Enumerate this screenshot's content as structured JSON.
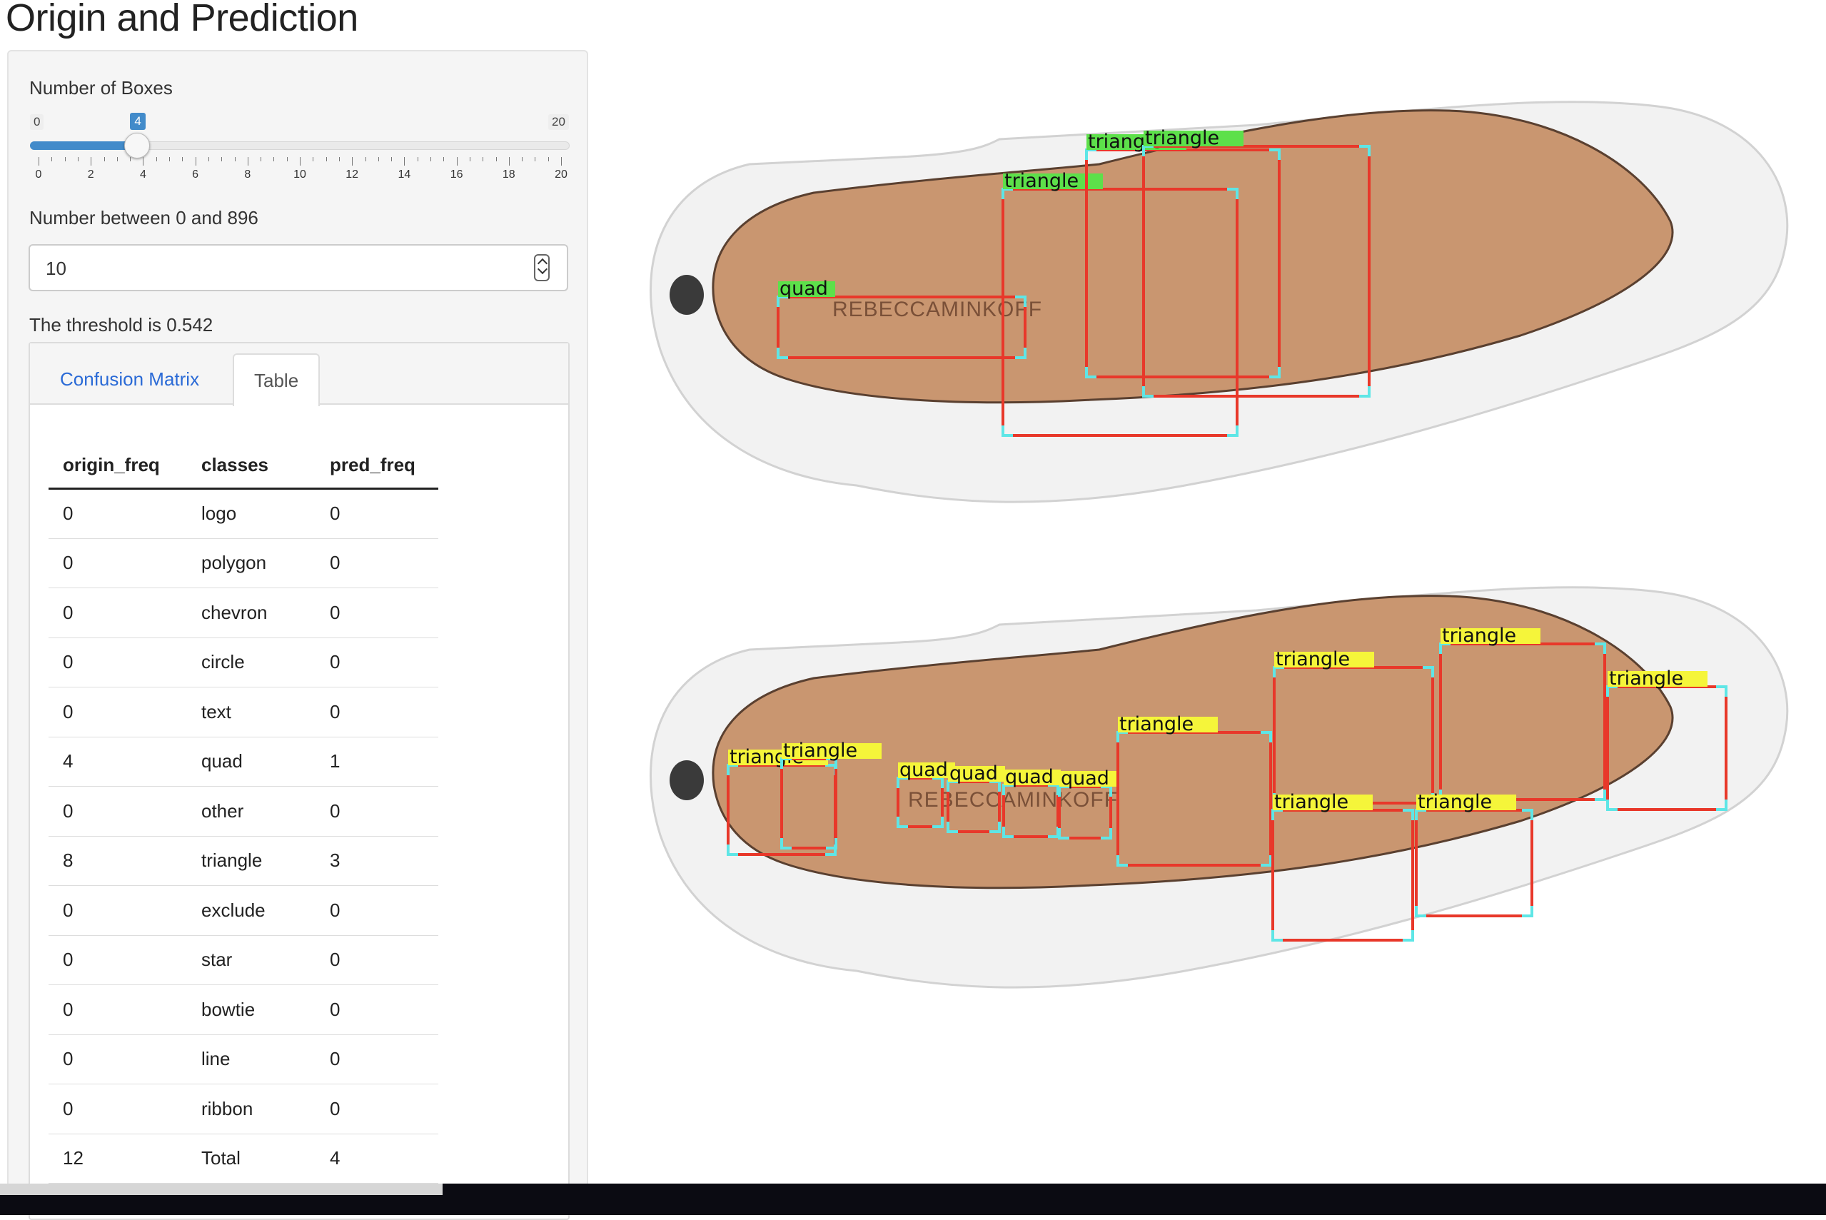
{
  "page": {
    "title": "Origin and Prediction"
  },
  "controls": {
    "boxes_label": "Number of Boxes",
    "slider": {
      "min": "0",
      "max": "20",
      "value": "4",
      "value_num": 4,
      "min_num": 0,
      "max_num": 20,
      "tick_labels": [
        "0",
        "2",
        "4",
        "6",
        "8",
        "10",
        "12",
        "14",
        "16",
        "18",
        "20"
      ]
    },
    "number_label": "Number between 0 and 896",
    "number_value": "10",
    "threshold_text": "The threshold is 0.542"
  },
  "tabs": [
    {
      "label": "Confusion Matrix",
      "active": false
    },
    {
      "label": "Table",
      "active": true
    }
  ],
  "table": {
    "headers": [
      "origin_freq",
      "classes",
      "pred_freq"
    ],
    "rows": [
      [
        "0",
        "logo",
        "0"
      ],
      [
        "0",
        "polygon",
        "0"
      ],
      [
        "0",
        "chevron",
        "0"
      ],
      [
        "0",
        "circle",
        "0"
      ],
      [
        "0",
        "text",
        "0"
      ],
      [
        "4",
        "quad",
        "1"
      ],
      [
        "0",
        "other",
        "0"
      ],
      [
        "8",
        "triangle",
        "3"
      ],
      [
        "0",
        "exclude",
        "0"
      ],
      [
        "0",
        "star",
        "0"
      ],
      [
        "0",
        "bowtie",
        "0"
      ],
      [
        "0",
        "line",
        "0"
      ],
      [
        "0",
        "ribbon",
        "0"
      ],
      [
        "12",
        "Total",
        "4"
      ]
    ]
  },
  "images": {
    "sole_brand": "REBECCAMINKOFF",
    "top_labels": [
      "quad",
      "triangle",
      "triangle",
      "triangle"
    ],
    "bottom_labels": [
      "triangle",
      "triangle",
      "quad",
      "quad",
      "quad",
      "quad",
      "triangle",
      "triangle",
      "triangle",
      "triangle",
      "triangle",
      "triangle"
    ],
    "colors": {
      "box": "#e8382a",
      "corner": "#5ee6e6",
      "origin_tag": "#5de04a",
      "pred_tag": "#f5f53a"
    }
  }
}
